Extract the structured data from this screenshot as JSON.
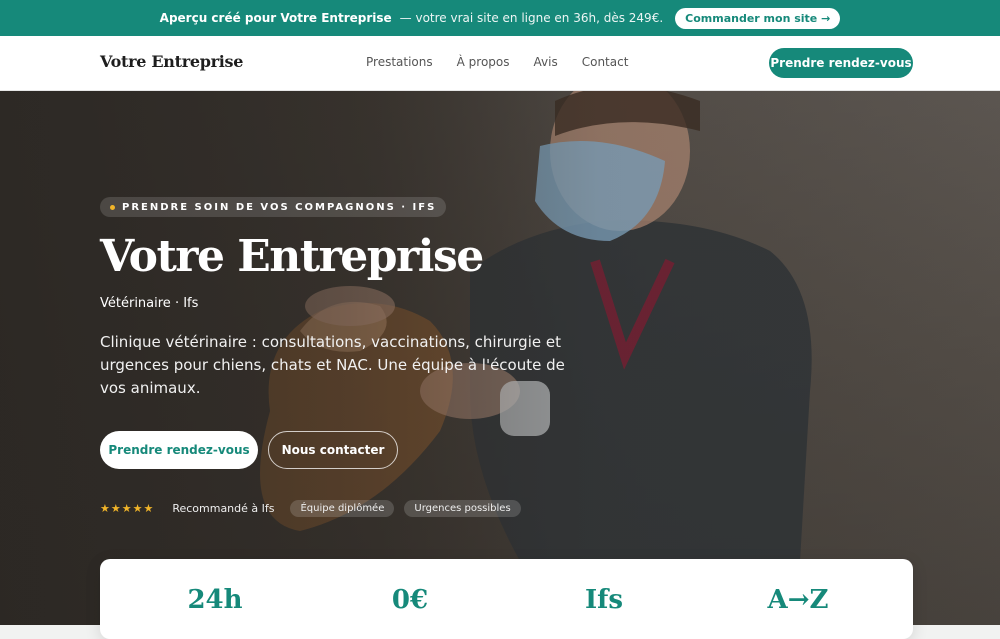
{
  "topbar": {
    "prefix": "Aperçu créé pour Votre Entreprise",
    "text": "— votre vrai site en ligne en 36h, dès 249€.",
    "cta": "Commander mon site →"
  },
  "nav": {
    "brand": "Votre Entreprise",
    "links": [
      "Prestations",
      "À propos",
      "Avis",
      "Contact"
    ],
    "cta": "Prendre rendez-vous"
  },
  "hero": {
    "pill": "PRENDRE SOIN DE VOS COMPAGNONS · IFS",
    "title": "Votre Entreprise",
    "subtitle": "Vétérinaire · Ifs",
    "description": "Clinique vétérinaire : consultations, vaccinations, chirurgie et urgences pour chiens, chats et NAC. Une équipe à l'écoute de vos animaux.",
    "primary_cta": "Prendre rendez-vous",
    "secondary_cta": "Nous contacter",
    "stars": "★★★★★",
    "recommended": "Recommandé à Ifs",
    "tags": [
      "Équipe diplômée",
      "Urgences possibles"
    ]
  },
  "stats": [
    "24h",
    "0€",
    "Ifs",
    "A→Z"
  ],
  "colors": {
    "accent": "#16897a",
    "star": "#f0b429"
  }
}
